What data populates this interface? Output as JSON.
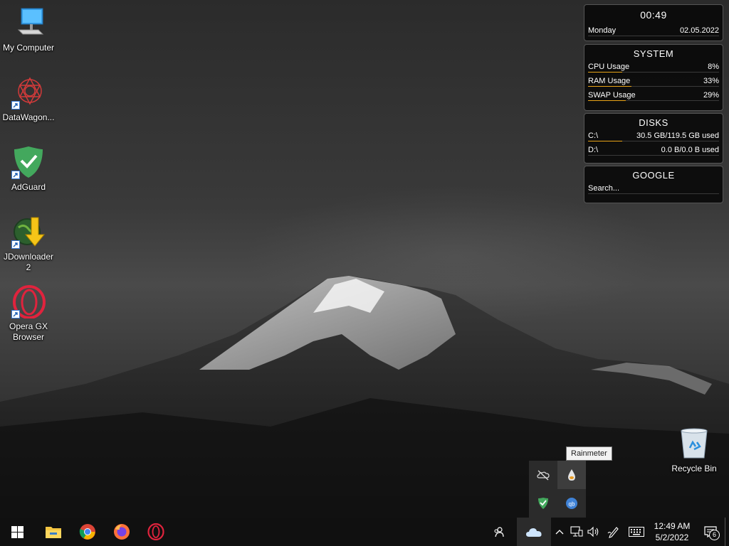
{
  "desktop": {
    "icons": [
      {
        "label": "My Computer",
        "icon": "computer-icon"
      },
      {
        "label": "DataWagon...",
        "icon": "datawagon-icon"
      },
      {
        "label": "AdGuard",
        "icon": "adguard-icon"
      },
      {
        "label": "JDownloader 2",
        "icon": "jdownloader-icon"
      },
      {
        "label": "Opera GX Browser",
        "icon": "opera-gx-icon"
      },
      {
        "label": "Recycle Bin",
        "icon": "recycle-bin-icon"
      }
    ]
  },
  "rainmeter": {
    "clock": {
      "time": "00:49",
      "day": "Monday",
      "date": "02.05.2022"
    },
    "system": {
      "title": "SYSTEM",
      "rows": [
        {
          "label": "CPU Usage",
          "value": "8%",
          "level": 0.08
        },
        {
          "label": "RAM Usage",
          "value": "33%",
          "level": 0.33
        },
        {
          "label": "SWAP Usage",
          "value": "29%",
          "level": 0.29
        }
      ]
    },
    "disks": {
      "title": "DISKS",
      "rows": [
        {
          "label": "C:\\",
          "value": "30.5 GB/119.5 GB used",
          "level": 0.255
        },
        {
          "label": "D:\\",
          "value": "0.0 B/0.0 B used",
          "level": 0
        }
      ]
    },
    "google": {
      "title": "GOOGLE",
      "placeholder": "Search..."
    }
  },
  "tooltip": "Rainmeter",
  "tray_flyout": [
    "onedrive-off-icon",
    "rainmeter-icon",
    "adguard-tray-icon",
    "qbittorrent-icon"
  ],
  "taskbar": {
    "pinned": [
      "start-icon",
      "file-explorer-icon",
      "chrome-icon",
      "firefox-icon",
      "opera-gx-icon"
    ],
    "time": "12:49 AM",
    "date": "5/2/2022",
    "notification_count": "6"
  },
  "colors": {
    "accent_bar": "#e8a317",
    "taskbar": "#101010"
  }
}
